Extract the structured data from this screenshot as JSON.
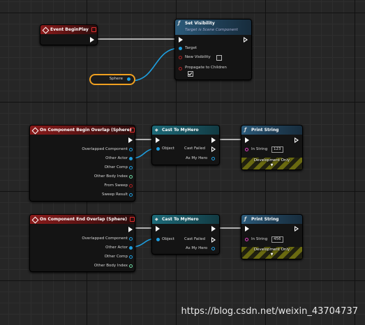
{
  "event_begin_play": {
    "title": "Event BeginPlay"
  },
  "set_visibility": {
    "title": "Set Visibility",
    "subtitle": "Target is Scene Component",
    "pins": {
      "target": "Target",
      "new_visibility": "New Visibility",
      "propagate": "Propagate to Children"
    },
    "new_visibility_checked": false,
    "propagate_checked": true
  },
  "sphere_var": {
    "label": "Sphere"
  },
  "begin_overlap": {
    "title": "On Component Begin Overlap (Sphere)",
    "pins": [
      "Overlapped Component",
      "Other Actor",
      "Other Comp",
      "Other Body Index",
      "From Sweep",
      "Sweep Result"
    ]
  },
  "cast1": {
    "title": "Cast To MyHero",
    "object": "Object",
    "cast_failed": "Cast Failed",
    "as_hero": "As My Hero"
  },
  "print1": {
    "title": "Print String",
    "in_string_label": "In String",
    "in_string_value": "123",
    "dev_only": "Development Only"
  },
  "end_overlap": {
    "title": "On Component End Overlap (Sphere)",
    "pins": [
      "Overlapped Component",
      "Other Actor",
      "Other Comp",
      "Other Body Index"
    ]
  },
  "cast2": {
    "title": "Cast To MyHero",
    "object": "Object",
    "cast_failed": "Cast Failed",
    "as_hero": "As My Hero"
  },
  "print2": {
    "title": "Print String",
    "in_string_label": "In String",
    "in_string_value": "456",
    "dev_only": "Development Only"
  },
  "watermark": "https://blog.csdn.net/weixin_43704737",
  "colors": {
    "exec": "#ffffff",
    "object_pin": "#1e9fe0",
    "event_header": "#8a1b1b",
    "cast_header": "#1d6a78",
    "function_header": "#2c5b7a",
    "selected_outline": "#f0a020"
  }
}
